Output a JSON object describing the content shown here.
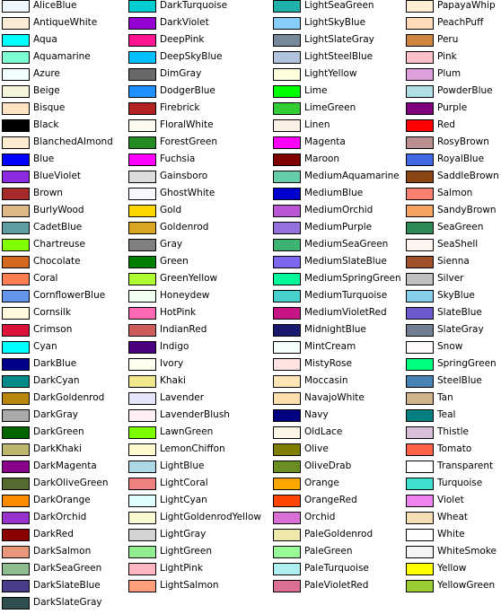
{
  "columns": [
    [
      "AliceBlue",
      "AntiqueWhite",
      "Aqua",
      "Aquamarine",
      "Azure",
      "Beige",
      "Bisque",
      "Black",
      "BlanchedAlmond",
      "Blue",
      "BlueViolet",
      "Brown",
      "BurlyWood",
      "CadetBlue",
      "Chartreuse",
      "Chocolate",
      "Coral",
      "CornflowerBlue",
      "Cornsilk",
      "Crimson",
      "Cyan",
      "DarkBlue",
      "DarkCyan",
      "DarkGoldenrod",
      "DarkGray",
      "DarkGreen",
      "DarkKhaki",
      "DarkMagenta",
      "DarkOliveGreen",
      "DarkOrange",
      "DarkOrchid",
      "DarkRed",
      "DarkSalmon",
      "DarkSeaGreen",
      "DarkSlateBlue",
      "DarkSlateGray"
    ],
    [
      "DarkTurquoise",
      "DarkViolet",
      "DeepPink",
      "DeepSkyBlue",
      "DimGray",
      "DodgerBlue",
      "Firebrick",
      "FloralWhite",
      "ForestGreen",
      "Fuchsia",
      "Gainsboro",
      "GhostWhite",
      "Gold",
      "Goldenrod",
      "Gray",
      "Green",
      "GreenYellow",
      "Honeydew",
      "HotPink",
      "IndianRed",
      "Indigo",
      "Ivory",
      "Khaki",
      "Lavender",
      "LavenderBlush",
      "LawnGreen",
      "LemonChiffon",
      "LightBlue",
      "LightCoral",
      "LightCyan",
      "LightGoldenrodYellow",
      "LightGray",
      "LightGreen",
      "LightPink",
      "LightSalmon"
    ],
    [
      "LightSeaGreen",
      "LightSkyBlue",
      "LightSlateGray",
      "LightSteelBlue",
      "LightYellow",
      "Lime",
      "LimeGreen",
      "Linen",
      "Magenta",
      "Maroon",
      "MediumAquamarine",
      "MediumBlue",
      "MediumOrchid",
      "MediumPurple",
      "MediumSeaGreen",
      "MediumSlateBlue",
      "MediumSpringGreen",
      "MediumTurquoise",
      "MediumVioletRed",
      "MidnightBlue",
      "MintCream",
      "MistyRose",
      "Moccasin",
      "NavajoWhite",
      "Navy",
      "OldLace",
      "Olive",
      "OliveDrab",
      "Orange",
      "OrangeRed",
      "Orchid",
      "PaleGoldenrod",
      "PaleGreen",
      "PaleTurquoise",
      "PaleVioletRed"
    ],
    [
      "PapayaWhip",
      "PeachPuff",
      "Peru",
      "Pink",
      "Plum",
      "PowderBlue",
      "Purple",
      "Red",
      "RosyBrown",
      "RoyalBlue",
      "SaddleBrown",
      "Salmon",
      "SandyBrown",
      "SeaGreen",
      "SeaShell",
      "Sienna",
      "Silver",
      "SkyBlue",
      "SlateBlue",
      "SlateGray",
      "Snow",
      "SpringGreen",
      "SteelBlue",
      "Tan",
      "Teal",
      "Thistle",
      "Tomato",
      "Transparent",
      "Turquoise",
      "Violet",
      "Wheat",
      "White",
      "WhiteSmoke",
      "Yellow",
      "YellowGreen"
    ]
  ]
}
